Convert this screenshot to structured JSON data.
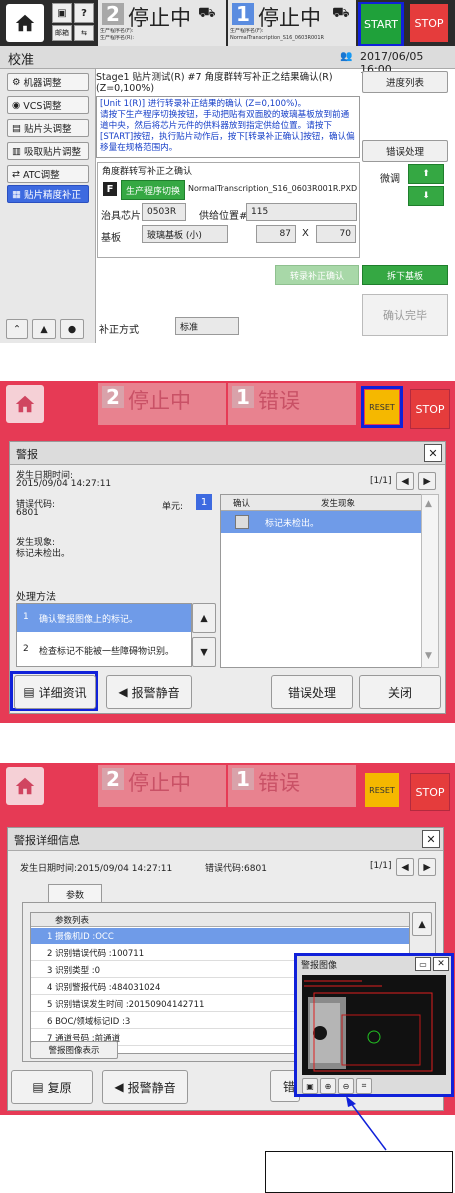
{
  "p1": {
    "header": {
      "mail_label": "邮箱",
      "help_label": "?",
      "lane2_num": "2",
      "lane2_status": "停止中",
      "lane1_num": "1",
      "lane1_status": "停止中",
      "prog_label_1": "生产程序名(F):",
      "prog_label_2": "生产程序名(R):",
      "prog_name": "NormalTranscription_S16_0603R001R",
      "start_label": "START",
      "stop_label": "STOP"
    },
    "title": "校准",
    "datetime": "2017/06/05 16:00",
    "side_buttons": [
      "机器调整",
      "VCS调整",
      "贴片头调整",
      "吸取贴片调整",
      "ATC调整",
      "贴片精度补正"
    ],
    "stage_line": "Stage1 贴片测试(R) #7 角度群转写补正之结果确认(R)(Z=0,100%)",
    "progress_btn": "进度列表",
    "instructions": "[Unit 1(R)] 进行转录补正结果的确认 (Z=0,100%)。\n请按下生产程序切换按钮，手动把贴有双面胶的玻璃基板放到前通道中央，然后将芯片元件的供料器放到指定供给位置。请按下[START]按钮，执行贴片动作后，按下[转录补正确认]按钮，确认偏移量在规格范围内。",
    "error_btn": "错误处理",
    "confirm_box_title": "角度群转写补正之确认",
    "f_label": "F",
    "switch_btn": "生产程序切换",
    "switch_prog": "NormalTranscription_S16_0603R001R.PXD",
    "chip_label": "治具芯片",
    "chip_value": "0503R",
    "feed_label": "供给位置#",
    "feed_value": "115",
    "board_label": "基板",
    "board_value": "玻璃基板 (小)",
    "board_x": "87",
    "x_label": "X",
    "board_y": "70",
    "fine_label": "微调",
    "trans_btn": "转录补正确认",
    "remove_btn": "拆下基板",
    "done_btn": "确认完毕",
    "method_label": "补正方式",
    "method_value": "标准"
  },
  "p2": {
    "header": {
      "lane2_num": "2",
      "lane2_status": "停止中",
      "lane1_num": "1",
      "lane1_status": "错误",
      "reset_label": "RESET",
      "stop_label": "STOP"
    },
    "dialog_title": "警报",
    "time_label": "发生日期时间:",
    "time_value": "2015/09/04 14:27:11",
    "page": "[1/1]",
    "code_label": "错误代码:",
    "code_value": "6801",
    "unit_label": "单元:",
    "unit_value": "1",
    "table_head": [
      "确认",
      "发生现象"
    ],
    "table_row": "标记未检出。",
    "phen_label": "发生现象:",
    "phen_value": "标记未检出。",
    "method_title": "处理方法",
    "methods": [
      {
        "n": "1",
        "t": "确认警报图像上的标记。"
      },
      {
        "n": "2",
        "t": "检查标记不能被一些障碍物识别。"
      }
    ],
    "btns": [
      "详细资讯",
      "报警静音",
      "错误处理",
      "关闭"
    ]
  },
  "p3": {
    "header": {
      "lane2_num": "2",
      "lane2_status": "停止中",
      "lane1_num": "1",
      "lane1_status": "错误",
      "reset_label": "RESET",
      "stop_label": "STOP"
    },
    "dialog_title": "警报详细信息",
    "time_line": "发生日期时间:2015/09/04 14:27:11",
    "code_line": "错误代码:6801",
    "page": "[1/1]",
    "tab": "参数",
    "list_title": "参数列表",
    "params": [
      "1 摄像机ID :OCC",
      "2 识别错误代码 :100711",
      "3 识别类型 :0",
      "4 识别警报代码 :484031024",
      "5 识别错误发生时间 :20150904142711",
      "6 BOC/领域标记ID :3",
      "7 通道号码 :前通道"
    ],
    "image_btn": "警报图像表示",
    "btns": [
      "复原",
      "报警静音",
      "错"
    ],
    "popup_title": "警报图像"
  }
}
